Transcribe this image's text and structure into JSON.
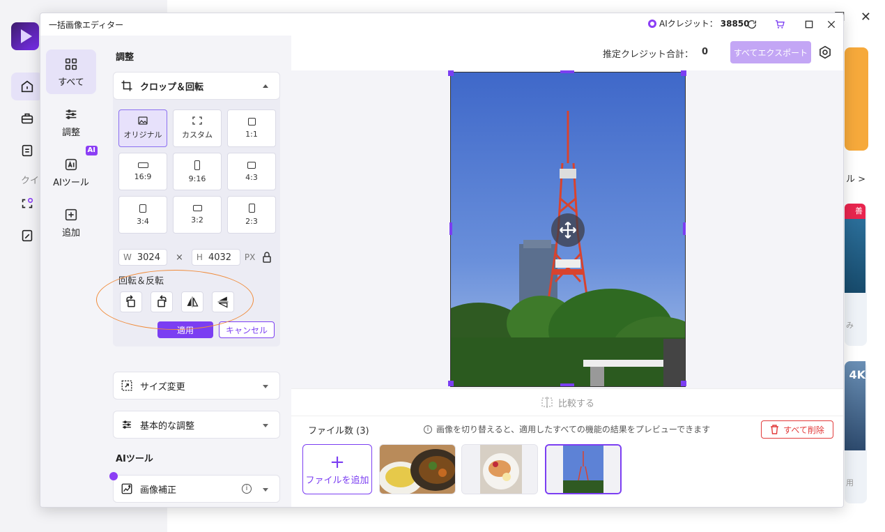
{
  "background": {
    "quick_label": "クイ",
    "link_text": "ル >",
    "card2_badge": "善",
    "card2_bottom": "み",
    "card3_badge": "4K",
    "card3_bottom": "用"
  },
  "dialog": {
    "title": "一括画像エディター",
    "credits_label": "AIクレジット：",
    "credits_value": "38850"
  },
  "nav": {
    "items": [
      {
        "label": "すべて"
      },
      {
        "label": "調整"
      },
      {
        "label": "AIツール",
        "badge": "AI"
      },
      {
        "label": "追加"
      }
    ]
  },
  "panel": {
    "title": "調整",
    "crop": {
      "header": "クロップ＆回転",
      "ratios": [
        "オリジナル",
        "カスタム",
        "1:1",
        "16:9",
        "9:16",
        "4:3",
        "3:4",
        "3:2",
        "2:3"
      ],
      "width_label": "W",
      "width": "3024",
      "times": "×",
      "height_label": "H",
      "height": "4032",
      "unit": "PX",
      "rotate_label": "回転＆反転",
      "apply": "適用",
      "cancel": "キャンセル"
    },
    "resize": "サイズ変更",
    "basic": "基本的な調整",
    "ai_title": "AIツール",
    "enhance": "画像補正",
    "enhance_info": "i"
  },
  "main": {
    "estimate_label": "推定クレジット合計：",
    "estimate_value": "0",
    "export_all": "すべてエクスポート",
    "compare": "比較する",
    "files_label": "ファイル数 (3)",
    "files_info": "画像を切り替えると、適用したすべての機能の結果をプレビューできます",
    "info_i": "i",
    "delete_all": "すべて削除",
    "add_file": "ファイルを追加",
    "add_plus": "+"
  },
  "colors": {
    "accent": "#7b3ef2",
    "highlight": "#f08b3a",
    "danger": "#e23a3a"
  }
}
